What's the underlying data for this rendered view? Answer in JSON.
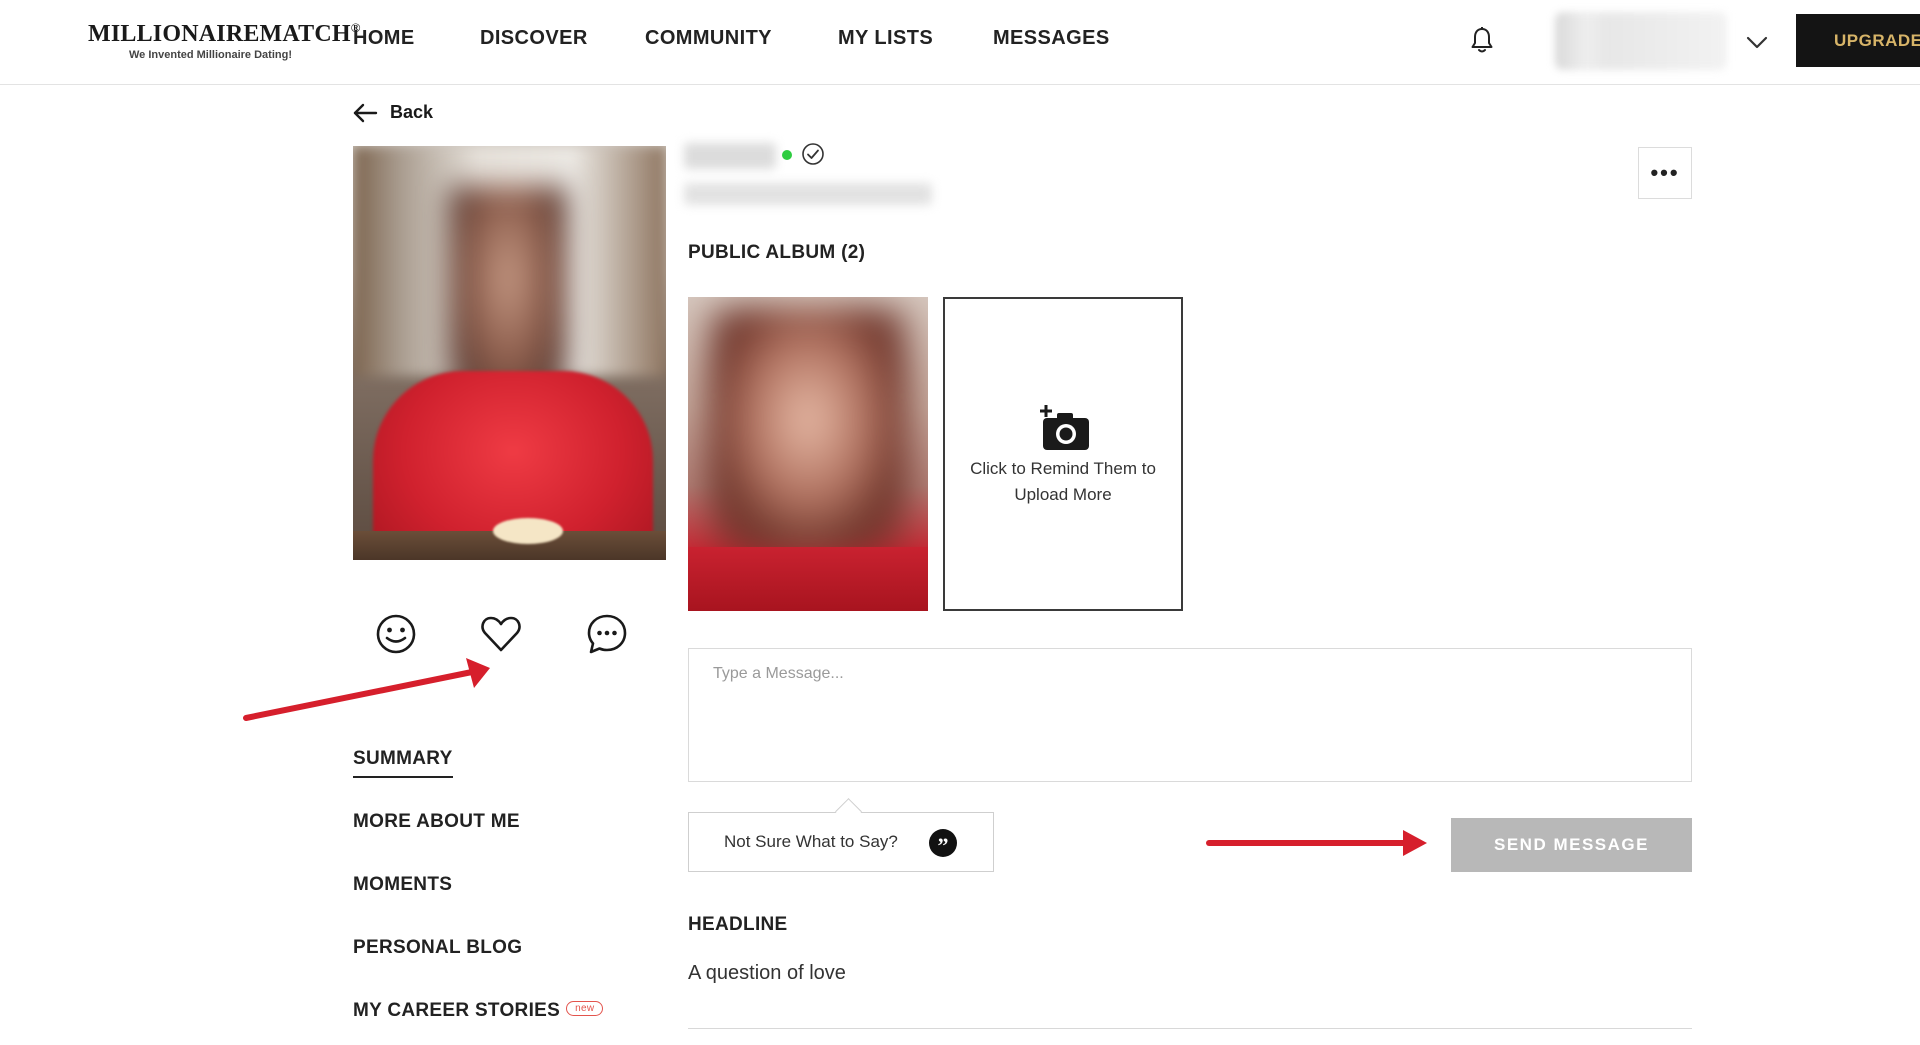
{
  "brand": {
    "name": "MILLIONAIREMATCH",
    "trademark": "®",
    "tagline": "We Invented Millionaire Dating!"
  },
  "nav": {
    "items": [
      "HOME",
      "DISCOVER",
      "COMMUNITY",
      "MY LISTS",
      "MESSAGES"
    ],
    "upgrade_label": "UPGRADE"
  },
  "back_label": "Back",
  "profile": {
    "online": true,
    "verified": true,
    "public_album_title": "PUBLIC ALBUM (2)",
    "remind_upload_text": "Click to Remind Them to Upload More",
    "actions": [
      "smile-icon",
      "heart-icon",
      "chat-icon"
    ]
  },
  "side_menu": {
    "items": [
      "SUMMARY",
      "MORE ABOUT ME",
      "MOMENTS",
      "PERSONAL BLOG",
      "MY CAREER STORIES"
    ],
    "active": "SUMMARY",
    "new_badge": "new"
  },
  "message": {
    "placeholder": "Type a Message...",
    "not_sure_label": "Not Sure What to Say?",
    "send_label": "SEND MESSAGE"
  },
  "headline": {
    "title": "HEADLINE",
    "text": "A question of love"
  },
  "colors": {
    "upgrade_bg": "#141414",
    "upgrade_text": "#d7b468",
    "online_dot": "#2ecc40",
    "send_button_bg": "#b8b8b8",
    "annotation_arrow": "#d61f2c",
    "new_badge": "#e3544d"
  }
}
